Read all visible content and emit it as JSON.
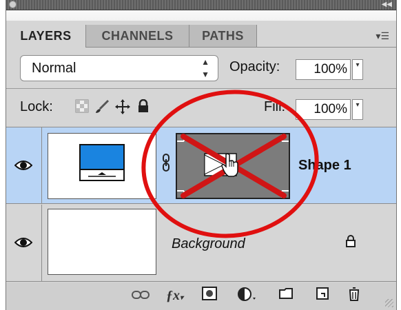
{
  "tabs": [
    {
      "label": "LAYERS",
      "active": true
    },
    {
      "label": "CHANNELS",
      "active": false
    },
    {
      "label": "PATHS",
      "active": false
    }
  ],
  "blend": {
    "mode": "Normal"
  },
  "opacity": {
    "label": "Opacity:",
    "value": "100%"
  },
  "lock": {
    "label": "Lock:"
  },
  "fill": {
    "label": "Fill:",
    "value": "100%"
  },
  "layers": [
    {
      "name": "Shape 1",
      "selected": true
    },
    {
      "name": "Background",
      "selected": false
    }
  ],
  "colors": {
    "selected_row": "#b8d4f5",
    "shape_blue": "#1a84e0",
    "annotation_red": "#e01010"
  }
}
